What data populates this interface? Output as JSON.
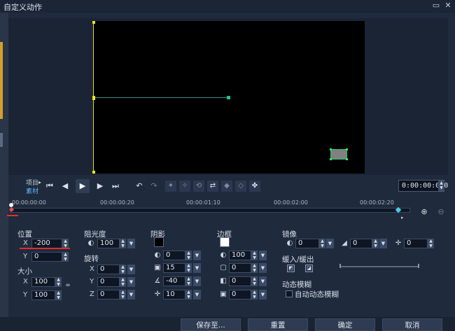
{
  "window": {
    "title": "自定义动作",
    "restore_glyph": "▭",
    "close_glyph": "✕"
  },
  "transport": {
    "label_project": "项目",
    "label_clip": "素材",
    "timecode": "0:00:00:000",
    "icons": [
      "go-start-icon",
      "step-back-icon",
      "play-icon",
      "step-forward-icon",
      "go-end-icon",
      "undo-icon",
      "redo-icon",
      "add-keyframe-icon",
      "remove-keyframe-icon",
      "reverse-keyframes-icon",
      "swap-keyframes-icon",
      "prev-keyframe-icon",
      "next-keyframe-icon",
      "keyframe-settings-icon"
    ]
  },
  "ruler": {
    "ticks": [
      "00:00:00:00",
      "00:00:00:20",
      "00:00:01:10",
      "00:00:02:00",
      "00:00:02:20"
    ]
  },
  "position": {
    "title": "位置",
    "x_label": "X",
    "x": "-200",
    "y_label": "Y",
    "y": "0"
  },
  "size": {
    "title": "大小",
    "x_label": "X",
    "x": "100",
    "y_label": "Y",
    "y": "100"
  },
  "opacity": {
    "title": "阻光度",
    "value": "100"
  },
  "rotation": {
    "title": "旋转",
    "x_label": "X",
    "x": "0",
    "y_label": "Y",
    "y": "0",
    "z_label": "Z",
    "z": "0"
  },
  "shadow": {
    "title": "阴影",
    "color": "#000000",
    "opacity": "0",
    "blur": "15",
    "angle": "-40",
    "distance": "10"
  },
  "border": {
    "title": "边框",
    "color": "#ffffff",
    "opacity": "100",
    "width": "0",
    "blur": "0",
    "roundness": "0"
  },
  "mirror": {
    "title": "镜像",
    "v1": "0",
    "v2": "0",
    "v3": "0"
  },
  "ease": {
    "title": "缓入/缓出"
  },
  "motion_blur": {
    "title": "动态模糊",
    "auto_label": "自动动态模糊"
  },
  "buttons": {
    "save": "保存至...",
    "reset": "重置",
    "ok": "确定",
    "cancel": "取消"
  }
}
